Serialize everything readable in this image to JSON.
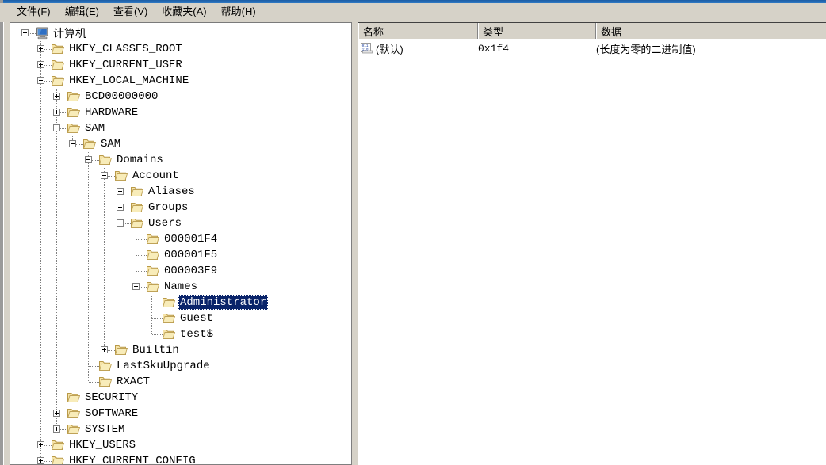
{
  "window": {
    "title_bar_color": "#1b5ea6",
    "chrome_color": "#d6d2c8"
  },
  "menubar": {
    "items": [
      {
        "label": "文件(F)",
        "name": "menu-file"
      },
      {
        "label": "编辑(E)",
        "name": "menu-edit"
      },
      {
        "label": "查看(V)",
        "name": "menu-view"
      },
      {
        "label": "收藏夹(A)",
        "name": "menu-favorites"
      },
      {
        "label": "帮助(H)",
        "name": "menu-help"
      }
    ]
  },
  "tree": {
    "selected_key": "Administrator",
    "selection_color": "#0a246a",
    "nodes": [
      {
        "label": "计算机",
        "depth": 0,
        "icon": "computer-icon",
        "expander": "minus",
        "cjk": true
      },
      {
        "label": "HKEY_CLASSES_ROOT",
        "depth": 1,
        "icon": "folder-icon",
        "expander": "plus"
      },
      {
        "label": "HKEY_CURRENT_USER",
        "depth": 1,
        "icon": "folder-icon",
        "expander": "plus"
      },
      {
        "label": "HKEY_LOCAL_MACHINE",
        "depth": 1,
        "icon": "folder-icon",
        "expander": "minus"
      },
      {
        "label": "BCD00000000",
        "depth": 2,
        "icon": "folder-icon",
        "expander": "plus"
      },
      {
        "label": "HARDWARE",
        "depth": 2,
        "icon": "folder-icon",
        "expander": "plus"
      },
      {
        "label": "SAM",
        "depth": 2,
        "icon": "folder-icon",
        "expander": "minus"
      },
      {
        "label": "SAM",
        "depth": 3,
        "icon": "folder-icon",
        "expander": "minus"
      },
      {
        "label": "Domains",
        "depth": 4,
        "icon": "folder-icon",
        "expander": "minus"
      },
      {
        "label": "Account",
        "depth": 5,
        "icon": "folder-icon",
        "expander": "minus"
      },
      {
        "label": "Aliases",
        "depth": 6,
        "icon": "folder-icon",
        "expander": "plus"
      },
      {
        "label": "Groups",
        "depth": 6,
        "icon": "folder-icon",
        "expander": "plus"
      },
      {
        "label": "Users",
        "depth": 6,
        "icon": "folder-icon",
        "expander": "minus"
      },
      {
        "label": "000001F4",
        "depth": 7,
        "icon": "folder-icon",
        "expander": "none"
      },
      {
        "label": "000001F5",
        "depth": 7,
        "icon": "folder-icon",
        "expander": "none"
      },
      {
        "label": "000003E9",
        "depth": 7,
        "icon": "folder-icon",
        "expander": "none"
      },
      {
        "label": "Names",
        "depth": 7,
        "icon": "folder-icon",
        "expander": "minus"
      },
      {
        "label": "Administrator",
        "depth": 8,
        "icon": "folder-icon",
        "expander": "none",
        "selected": true
      },
      {
        "label": "Guest",
        "depth": 8,
        "icon": "folder-icon",
        "expander": "none"
      },
      {
        "label": "test$",
        "depth": 8,
        "icon": "folder-icon",
        "expander": "none"
      },
      {
        "label": "Builtin",
        "depth": 5,
        "icon": "folder-icon",
        "expander": "plus"
      },
      {
        "label": "LastSkuUpgrade",
        "depth": 4,
        "icon": "folder-icon",
        "expander": "none"
      },
      {
        "label": "RXACT",
        "depth": 4,
        "icon": "folder-icon",
        "expander": "none"
      },
      {
        "label": "SECURITY",
        "depth": 2,
        "icon": "folder-icon",
        "expander": "none"
      },
      {
        "label": "SOFTWARE",
        "depth": 2,
        "icon": "folder-icon",
        "expander": "plus"
      },
      {
        "label": "SYSTEM",
        "depth": 2,
        "icon": "folder-icon",
        "expander": "plus"
      },
      {
        "label": "HKEY_USERS",
        "depth": 1,
        "icon": "folder-icon",
        "expander": "plus"
      },
      {
        "label": "HKEY_CURRENT_CONFIG",
        "depth": 1,
        "icon": "folder-icon",
        "expander": "plus"
      }
    ]
  },
  "list": {
    "columns": [
      {
        "label": "名称",
        "name": "column-name"
      },
      {
        "label": "类型",
        "name": "column-type"
      },
      {
        "label": "数据",
        "name": "column-data"
      }
    ],
    "rows": [
      {
        "name": "(默认)",
        "type": "0x1f4",
        "data": "(长度为零的二进制值)",
        "icon": "binary-value-icon"
      }
    ]
  }
}
